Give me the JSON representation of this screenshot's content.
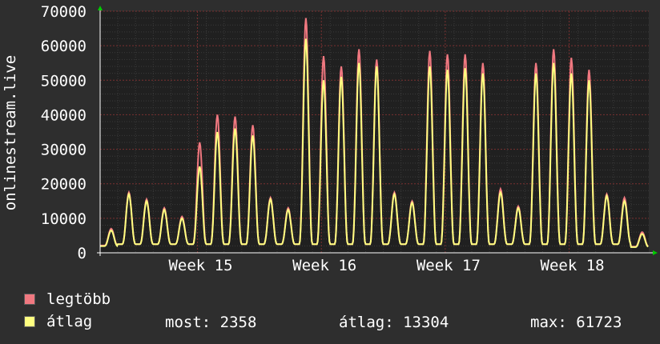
{
  "chart_data": {
    "type": "line",
    "ylabel": "onlinestream.live",
    "ylim": [
      0,
      70000
    ],
    "y_ticks": [
      "0",
      "10000",
      "20000",
      "30000",
      "40000",
      "50000",
      "60000",
      "70000"
    ],
    "x_ticks": [
      "Week 15",
      "Week 16",
      "Week 17",
      "Week 18"
    ],
    "grid": true,
    "legend_placement": "bottom-left",
    "days": 31,
    "daily_peaks": {
      "legtobb": [
        7000,
        17500,
        15500,
        13000,
        10500,
        32000,
        40000,
        39500,
        37000,
        16000,
        13000,
        68000,
        57000,
        54000,
        59000,
        56000,
        17500,
        15000,
        58500,
        57500,
        57500,
        55000,
        18500,
        13500,
        55000,
        59000,
        56500,
        53000,
        17000,
        16000,
        6000
      ],
      "atlag": [
        6500,
        17000,
        15000,
        12500,
        10000,
        25000,
        35000,
        36000,
        34000,
        15500,
        12500,
        62000,
        50000,
        51000,
        55000,
        54000,
        17000,
        14500,
        54000,
        53000,
        53500,
        52000,
        17500,
        13000,
        52000,
        55000,
        52000,
        50000,
        16500,
        15000,
        5500
      ]
    },
    "series": [
      {
        "name": "legtöbb",
        "color": "#f07880"
      },
      {
        "name": "átlag",
        "color": "#ffff80"
      }
    ]
  },
  "legend": {
    "items": [
      {
        "label": "legtöbb",
        "color": "#f07880"
      },
      {
        "label": "átlag",
        "color": "#ffff80"
      }
    ]
  },
  "stats": {
    "most": "most: 2358",
    "atlag": "átlag: 13304",
    "max": "max: 61723"
  }
}
